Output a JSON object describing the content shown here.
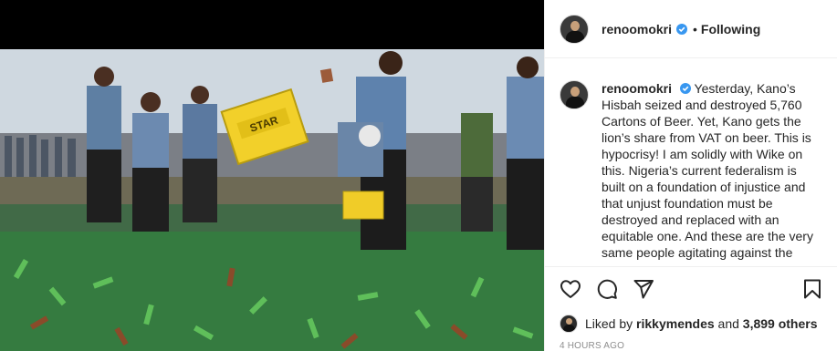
{
  "post": {
    "username": "renoomokri",
    "follow_separator": "•",
    "follow_status": "Following",
    "caption": "Yesterday, Kano’s Hisbah seized and destroyed 5,760 Cartons of Beer. Yet, Kano gets the lion’s share from VAT on beer. This is hypocrisy! I am solidly with Wike on this. Nigeria’s current federalism is built on a foundation of injustice and that unjust foundation must be destroyed and replaced with an equitable one. And these are the very same people agitating against the",
    "likes_prefix": "Liked by",
    "liked_by_user": "rikkymendes",
    "likes_and": "and",
    "others_count": "3,899 others",
    "timestamp": "4 HOURS AGO"
  },
  "crate_label": "STAR",
  "icons": {
    "verified": "verified-badge-icon",
    "like": "heart-icon",
    "comment": "comment-bubble-icon",
    "share": "paper-plane-icon",
    "save": "bookmark-icon"
  },
  "colors": {
    "verified_blue": "#3897f0",
    "text": "#262626",
    "muted": "#8e8e8e",
    "border": "#efefef"
  }
}
